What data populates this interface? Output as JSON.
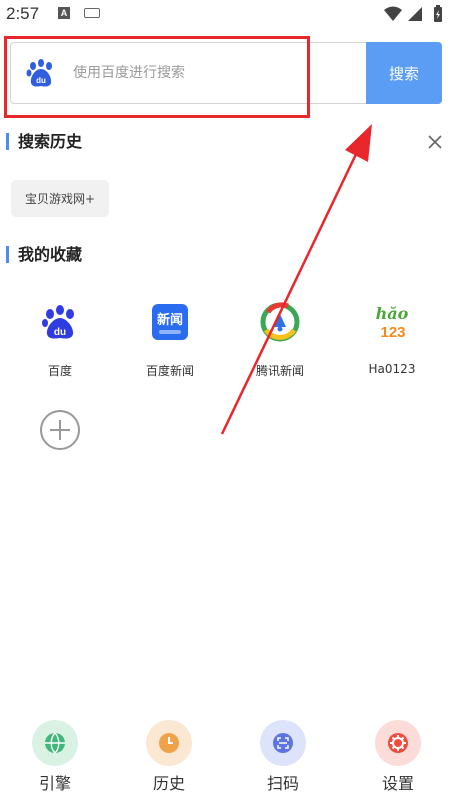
{
  "status_bar": {
    "time": "2:57",
    "notification_a": "A"
  },
  "search": {
    "placeholder": "使用百度进行搜索",
    "button_label": "搜索",
    "logo_icon": "baidu-paw-icon"
  },
  "history": {
    "title": "搜索历史",
    "items": [
      "宝贝游戏网+"
    ],
    "close_icon": "close-icon"
  },
  "favorites": {
    "title": "我的收藏",
    "items": [
      {
        "label": "百度",
        "icon": "baidu-icon"
      },
      {
        "label": "百度新闻",
        "icon": "baidu-news-icon"
      },
      {
        "label": "腾讯新闻",
        "icon": "tencent-news-icon"
      },
      {
        "label": "Ha0123",
        "icon": "hao123-icon"
      }
    ],
    "add_icon": "plus-icon",
    "news_icon_text": "新闻",
    "hao_icon_text": "hăo",
    "hao_icon_number": "123"
  },
  "bottom_nav": [
    {
      "label": "引擎",
      "icon": "globe-icon",
      "color": "#3fb77a"
    },
    {
      "label": "历史",
      "icon": "clock-icon",
      "color": "#f0a24a"
    },
    {
      "label": "扫码",
      "icon": "scan-icon",
      "color": "#5d74e6"
    },
    {
      "label": "设置",
      "icon": "gear-icon",
      "color": "#ef4c3c"
    }
  ],
  "colors": {
    "accent": "#5b9cf5",
    "annotation": "#e8262c"
  }
}
